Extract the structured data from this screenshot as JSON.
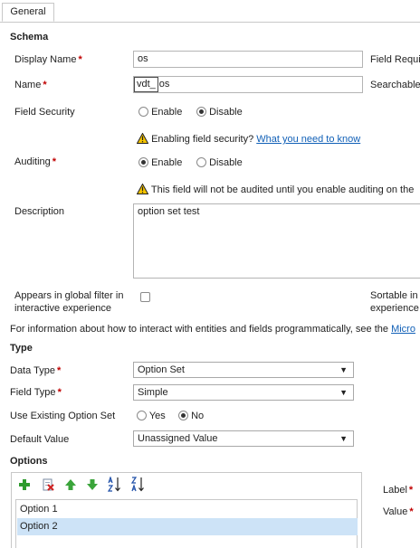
{
  "tabs": [
    {
      "label": "General"
    }
  ],
  "schema": {
    "title": "Schema",
    "display_name": {
      "label": "Display Name",
      "value": "os",
      "right_label": "Field Requir"
    },
    "name": {
      "label": "Name",
      "prefix": "vdt_",
      "value": "os",
      "right_label": "Searchable"
    },
    "field_security": {
      "label": "Field Security",
      "enable": "Enable",
      "disable": "Disable",
      "selected": "Disable"
    },
    "field_security_warning": {
      "text": "Enabling field security?",
      "link": "What you need to know"
    },
    "auditing": {
      "label": "Auditing",
      "enable": "Enable",
      "disable": "Disable",
      "selected": "Enable"
    },
    "auditing_warning": "This field will not be audited until you enable auditing on the",
    "description": {
      "label": "Description",
      "value": "option set test"
    },
    "global_filter": {
      "label_line1": "Appears in global filter in",
      "label_line2": "interactive experience",
      "right_label_line1": "Sortable in",
      "right_label_line2": "experience c"
    },
    "info": {
      "text": "For information about how to interact with entities and fields programmatically, see the",
      "link": "Micro"
    }
  },
  "type_section": {
    "title": "Type",
    "data_type": {
      "label": "Data Type",
      "value": "Option Set"
    },
    "field_type": {
      "label": "Field Type",
      "value": "Simple"
    },
    "use_existing": {
      "label": "Use Existing Option Set",
      "yes": "Yes",
      "no": "No",
      "selected": "No"
    },
    "default_value": {
      "label": "Default Value",
      "value": "Unassigned Value"
    }
  },
  "options_section": {
    "title": "Options",
    "items": [
      {
        "label": "Option 1"
      },
      {
        "label": "Option 2"
      }
    ],
    "selected_index": 1,
    "label_field": {
      "label": "Label"
    },
    "value_field": {
      "label": "Value"
    }
  },
  "icons": [
    "add-icon",
    "delete-icon",
    "move-up-icon",
    "move-down-icon",
    "sort-az-icon",
    "sort-za-icon",
    "warning-icon",
    "dropdown-arrow-icon"
  ],
  "colors": {
    "required": "#c00000",
    "link": "#1160b7",
    "selection": "#cde3f7",
    "add": "#2e9b2e",
    "arrow": "#3aa43a"
  }
}
